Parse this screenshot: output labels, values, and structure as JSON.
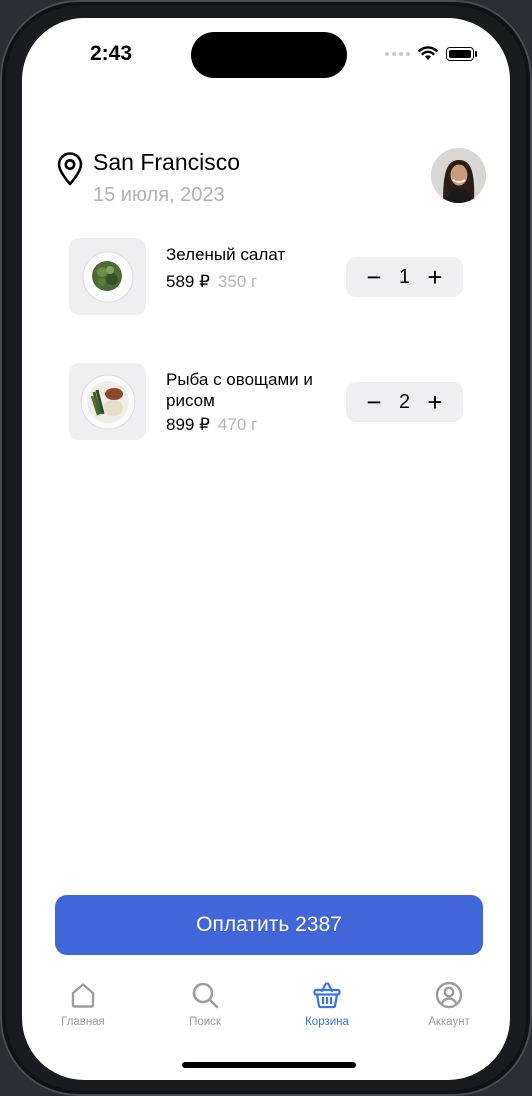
{
  "status_bar": {
    "time": "2:43"
  },
  "header": {
    "city": "San Francisco",
    "date": "15 июля, 2023",
    "icons": {
      "location": "location-pin-icon",
      "avatar": "user-avatar"
    }
  },
  "cart": {
    "items": [
      {
        "name": "Зеленый салат",
        "price": "589 ₽",
        "weight": "350 г",
        "quantity": "1",
        "minus": "−",
        "plus": "+"
      },
      {
        "name": "Рыба с овощами и рисом",
        "price": "899 ₽",
        "weight": "470 г",
        "quantity": "2",
        "minus": "−",
        "plus": "+"
      }
    ]
  },
  "pay_button": {
    "label": "Оплатить 2387"
  },
  "tabbar": {
    "tabs": [
      {
        "label": "Главная",
        "icon": "home-icon",
        "active": false
      },
      {
        "label": "Поиск",
        "icon": "search-icon",
        "active": false
      },
      {
        "label": "Корзина",
        "icon": "basket-icon",
        "active": true
      },
      {
        "label": "Аккаунт",
        "icon": "account-icon",
        "active": false
      }
    ]
  },
  "colors": {
    "accent": "#4166da",
    "active_tab": "#3b73e0",
    "muted": "#b1b1b6"
  }
}
